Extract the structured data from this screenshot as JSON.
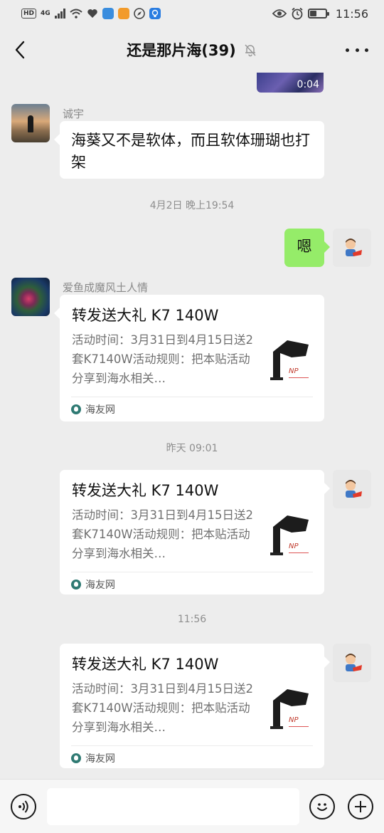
{
  "status_bar": {
    "hd": "HD",
    "network": "4G",
    "time": "11:56"
  },
  "header": {
    "title": "还是那片海(39)"
  },
  "video": {
    "duration": "0:04"
  },
  "messages": {
    "m1": {
      "sender": "诚宇",
      "text": "海葵又不是软体，而且软体珊瑚也打架"
    },
    "sep1": "4月2日 晚上19:54",
    "m2": {
      "text": "嗯"
    },
    "m3": {
      "sender": "爱鱼成魔风土人情",
      "card_title": "转发送大礼 K7 140W",
      "card_desc": "活动时间：3月31日到4月15日送2套K7140W活动规则：把本贴活动分享到海水相关…",
      "source": "海友网"
    },
    "sep2": "昨天 09:01",
    "m4": {
      "card_title": "转发送大礼 K7 140W",
      "card_desc": "活动时间：3月31日到4月15日送2套K7140W活动规则：把本贴活动分享到海水相关…",
      "source": "海友网"
    },
    "sep3": "11:56",
    "m5": {
      "card_title": "转发送大礼 K7 140W",
      "card_desc": "活动时间：3月31日到4月15日送2套K7140W活动规则：把本贴活动分享到海水相关…",
      "source": "海友网"
    }
  },
  "input": {
    "placeholder": ""
  },
  "colors": {
    "background": "#ededed",
    "own_bubble": "#95ec69",
    "bubble": "#ffffff"
  }
}
